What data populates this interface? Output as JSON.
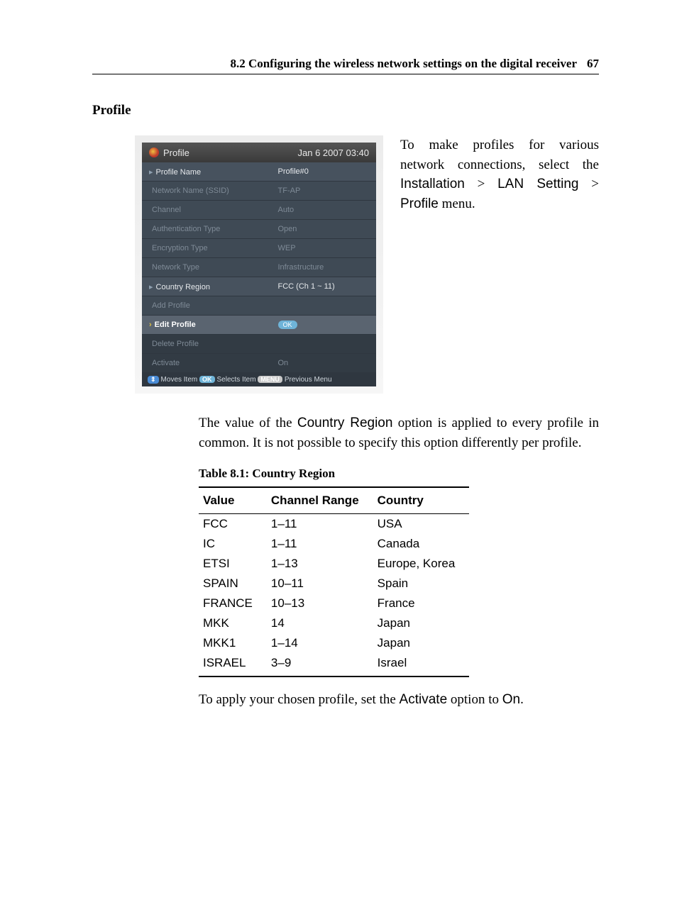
{
  "header": {
    "section": "8.2 Configuring the wireless network settings on the digital receiver",
    "page": "67"
  },
  "heading": "Profile",
  "shot": {
    "title": "Profile",
    "clock": "Jan 6 2007 03:40",
    "rows": [
      {
        "k": "Profile Name",
        "v": "Profile#0",
        "cls": "bright"
      },
      {
        "k": "Network Name (SSID)",
        "v": "TF-AP",
        "cls": "dim"
      },
      {
        "k": "Channel",
        "v": "Auto",
        "cls": "dim"
      },
      {
        "k": "Authentication Type",
        "v": "Open",
        "cls": "dim"
      },
      {
        "k": "Encryption Type",
        "v": "WEP",
        "cls": "dim"
      },
      {
        "k": "Network Type",
        "v": "Infrastructure",
        "cls": "dim"
      },
      {
        "k": "Country Region",
        "v": "FCC (Ch 1 ~ 11)",
        "cls": "bright"
      },
      {
        "k": "Add Profile",
        "v": "",
        "cls": "dim"
      },
      {
        "k": "Edit Profile",
        "v": "__OK__",
        "cls": "hl"
      },
      {
        "k": "Delete Profile",
        "v": "",
        "cls": "dim sep"
      },
      {
        "k": "Activate",
        "v": "On",
        "cls": "dim sep"
      }
    ],
    "help": {
      "moves": "Moves Item",
      "selects": "Selects Item",
      "prev": "Previous Menu",
      "ok": "OK",
      "menu": "MENU",
      "arrows": "⇕"
    }
  },
  "side": {
    "pre": "To make profiles for various network connections, select the ",
    "path1": "Installation",
    "gt1": " > ",
    "path2": "LAN Setting",
    "gt2": " > ",
    "path3": "Profile",
    "post": " menu."
  },
  "para1a": "The value of the ",
  "para1b": "Country Region",
  "para1c": " option is applied to every profile in common. It is not possible to specify this option differently per profile.",
  "tableCaption": "Table 8.1: Country Region",
  "tableHead": {
    "c1": "Value",
    "c2": "Channel Range",
    "c3": "Country"
  },
  "chart_data": {
    "type": "table",
    "columns": [
      "Value",
      "Channel Range",
      "Country"
    ],
    "rows": [
      [
        "FCC",
        "1–11",
        "USA"
      ],
      [
        "IC",
        "1–11",
        "Canada"
      ],
      [
        "ETSI",
        "1–13",
        "Europe, Korea"
      ],
      [
        "SPAIN",
        "10–11",
        "Spain"
      ],
      [
        "FRANCE",
        "10–13",
        "France"
      ],
      [
        "MKK",
        "14",
        "Japan"
      ],
      [
        "MKK1",
        "1–14",
        "Japan"
      ],
      [
        "ISRAEL",
        "3–9",
        "Israel"
      ]
    ]
  },
  "para2a": "To apply your chosen profile, set the ",
  "para2b": "Activate",
  "para2c": " option to ",
  "para2d": "On",
  "para2e": "."
}
